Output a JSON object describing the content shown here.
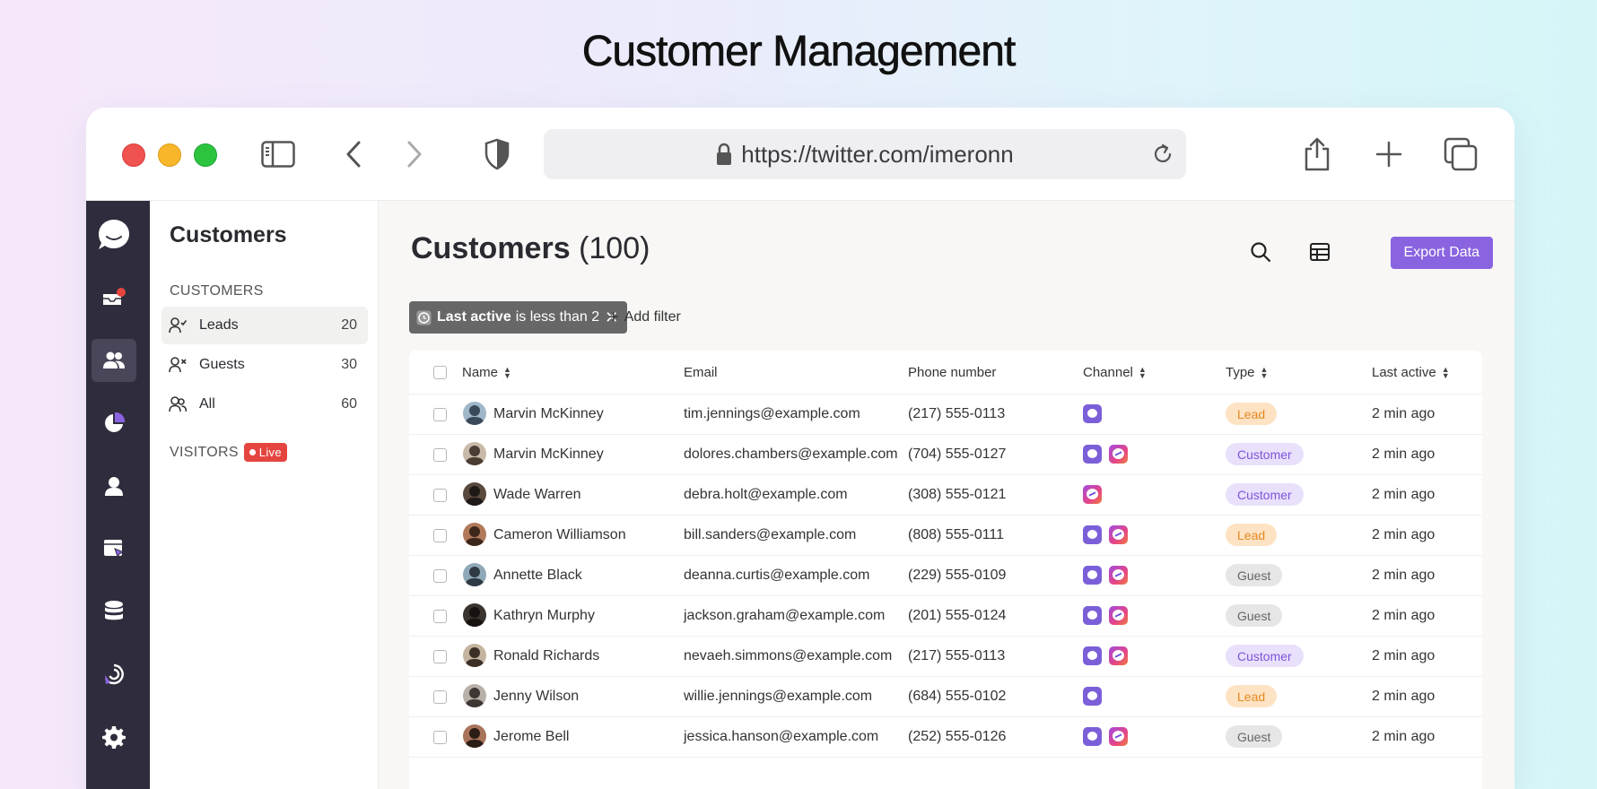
{
  "page_title": "Customer Management",
  "browser": {
    "url": "https://twitter.com/imeronn"
  },
  "subnav": {
    "title": "Customers",
    "section_customers": "CUSTOMERS",
    "items": [
      {
        "label": "Leads",
        "count": "20"
      },
      {
        "label": "Guests",
        "count": "30"
      },
      {
        "label": "All",
        "count": "60"
      }
    ],
    "section_visitors": "VISITORS",
    "live_label": "Live"
  },
  "main": {
    "title": "Customers",
    "count": "(100)",
    "export_label": "Export Data",
    "filter": {
      "field": "Last active",
      "text": "is less than 2"
    },
    "add_filter_label": "Add filter"
  },
  "colors": {
    "accent": "#8a63e0",
    "rail": "#2f2d3d",
    "lead": "#e38a22",
    "customer": "#7d55db",
    "guest": "#666666"
  },
  "table": {
    "columns": [
      "Name",
      "Email",
      "Phone number",
      "Channel",
      "Type",
      "Last active"
    ],
    "rows": [
      {
        "name": "Marvin McKinney",
        "email": "tim.jennings@example.com",
        "phone": "(217) 555-0113",
        "channels": [
          "chat"
        ],
        "type": "Lead",
        "last_active": "2 min ago"
      },
      {
        "name": "Marvin McKinney",
        "email": "dolores.chambers@example.com",
        "phone": "(704) 555-0127",
        "channels": [
          "chat",
          "messenger"
        ],
        "type": "Customer",
        "last_active": "2 min ago"
      },
      {
        "name": "Wade Warren",
        "email": "debra.holt@example.com",
        "phone": "(308) 555-0121",
        "channels": [
          "messenger"
        ],
        "type": "Customer",
        "last_active": "2 min ago"
      },
      {
        "name": "Cameron Williamson",
        "email": "bill.sanders@example.com",
        "phone": "(808) 555-0111",
        "channels": [
          "chat",
          "messenger"
        ],
        "type": "Lead",
        "last_active": "2 min ago"
      },
      {
        "name": "Annette Black",
        "email": "deanna.curtis@example.com",
        "phone": "(229) 555-0109",
        "channels": [
          "chat",
          "messenger"
        ],
        "type": "Guest",
        "last_active": "2 min ago"
      },
      {
        "name": "Kathryn Murphy",
        "email": "jackson.graham@example.com",
        "phone": "(201) 555-0124",
        "channels": [
          "chat",
          "messenger"
        ],
        "type": "Guest",
        "last_active": "2 min ago"
      },
      {
        "name": "Ronald Richards",
        "email": "nevaeh.simmons@example.com",
        "phone": "(217) 555-0113",
        "channels": [
          "chat",
          "messenger"
        ],
        "type": "Customer",
        "last_active": "2 min ago"
      },
      {
        "name": "Jenny Wilson",
        "email": "willie.jennings@example.com",
        "phone": "(684) 555-0102",
        "channels": [
          "chat"
        ],
        "type": "Lead",
        "last_active": "2 min ago"
      },
      {
        "name": "Jerome Bell",
        "email": "jessica.hanson@example.com",
        "phone": "(252) 555-0126",
        "channels": [
          "chat",
          "messenger"
        ],
        "type": "Guest",
        "last_active": "2 min ago"
      }
    ]
  }
}
